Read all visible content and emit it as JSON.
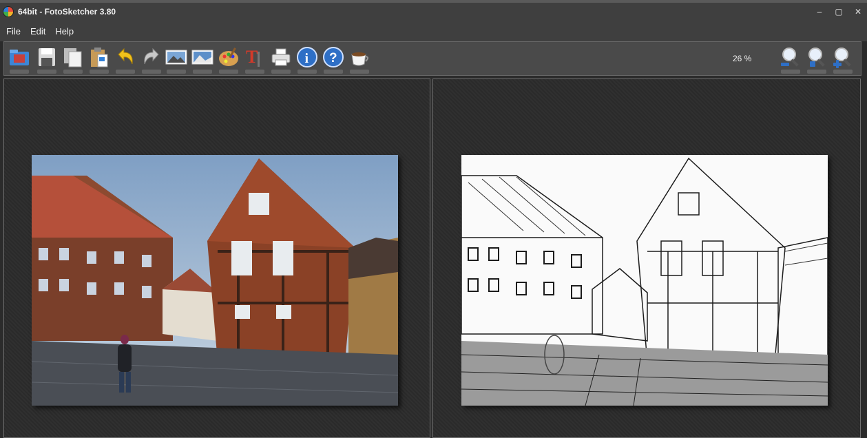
{
  "window": {
    "title": "64bit - FotoSketcher 3.80"
  },
  "menu": {
    "items": [
      "File",
      "Edit",
      "Help"
    ]
  },
  "toolbar": {
    "buttons": [
      "open-folder-icon",
      "save-icon",
      "copy-icon",
      "paste-icon",
      "undo-icon",
      "redo-icon",
      "original-image-icon",
      "result-image-icon",
      "palette-icon",
      "text-icon",
      "print-icon",
      "info-icon",
      "help-icon",
      "coffee-icon"
    ],
    "zoom_level": "26 %",
    "zoom_buttons": [
      "zoom-out-icon",
      "zoom-fit-icon",
      "zoom-in-icon"
    ]
  },
  "panels": {
    "left": {
      "name": "original-image"
    },
    "right": {
      "name": "sketch-result-image"
    }
  }
}
